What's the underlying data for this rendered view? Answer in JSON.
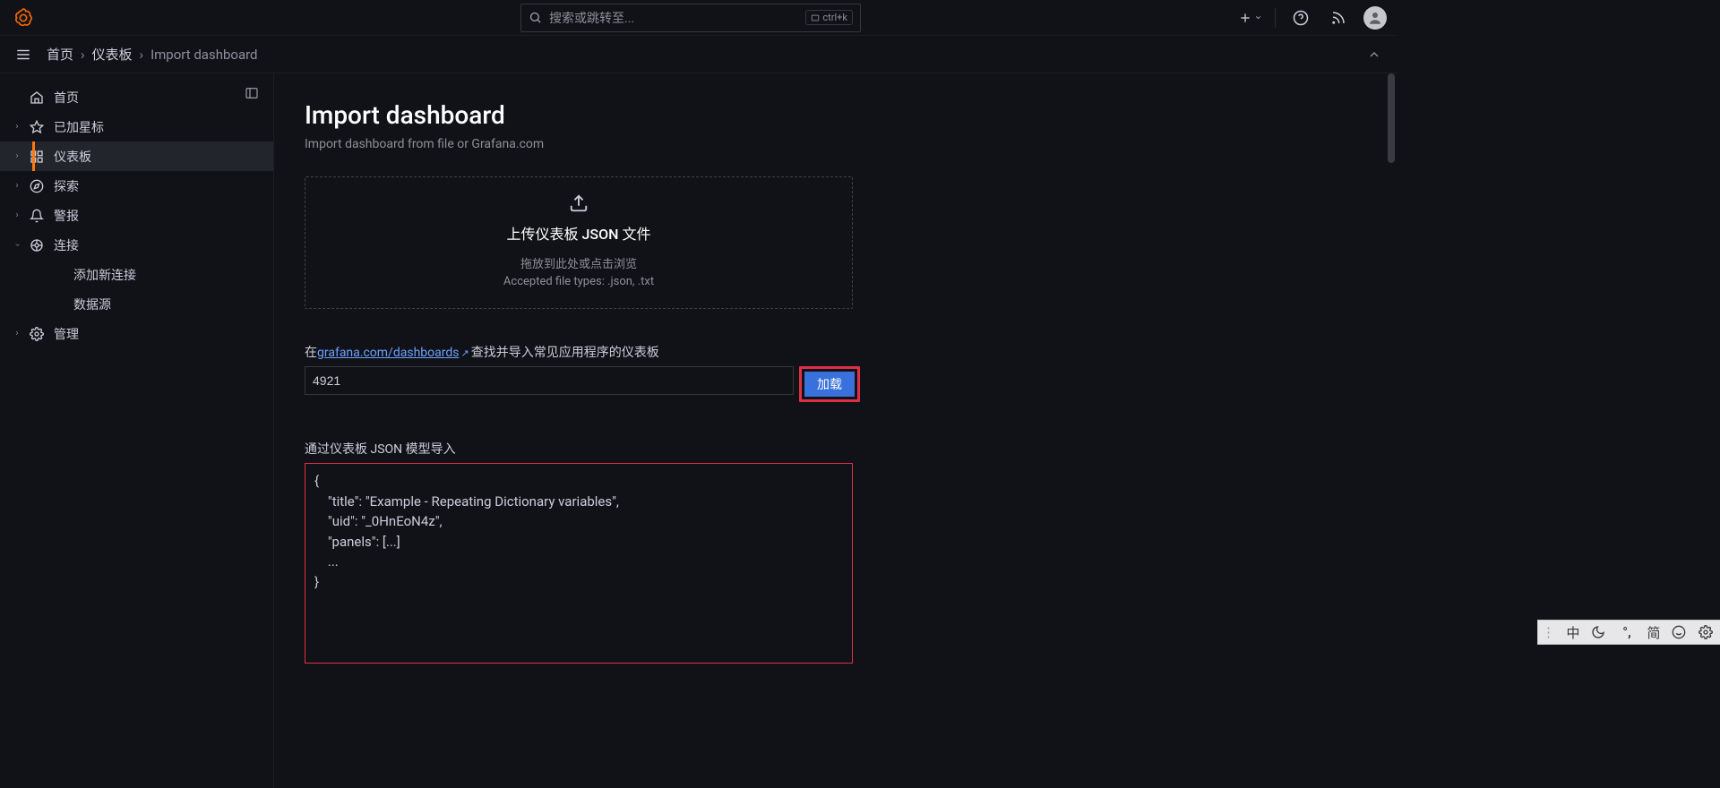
{
  "topbar": {
    "search_placeholder": "搜索或跳转至...",
    "kbd": "ctrl+k"
  },
  "breadcrumb": {
    "home": "首页",
    "dash": "仪表板",
    "current": "Import dashboard"
  },
  "sidebar": {
    "home": "首页",
    "starred": "已加星标",
    "dashboards": "仪表板",
    "explore": "探索",
    "alerts": "警报",
    "connect": "连接",
    "add_conn": "添加新连接",
    "datasources": "数据源",
    "admin": "管理"
  },
  "page": {
    "title": "Import dashboard",
    "subtitle": "Import dashboard from file or Grafana.com",
    "upload_title": "上传仪表板 JSON 文件",
    "upload_hint": "拖放到此处或点击浏览",
    "upload_types": "Accepted file types: .json, .txt",
    "hint_pre": "在",
    "hint_link": "grafana.com/dashboards",
    "hint_post": "查找并导入常见应用程序的仪表板",
    "id_value": "4921",
    "load_btn": "加载",
    "json_label": "通过仪表板 JSON 模型导入",
    "json_value": "{\n    \"title\": \"Example - Repeating Dictionary variables\",\n    \"uid\": \"_0HnEoN4z\",\n    \"panels\": [...]\n    ...\n}"
  },
  "ime": {
    "lang": "中",
    "simp": "简"
  }
}
